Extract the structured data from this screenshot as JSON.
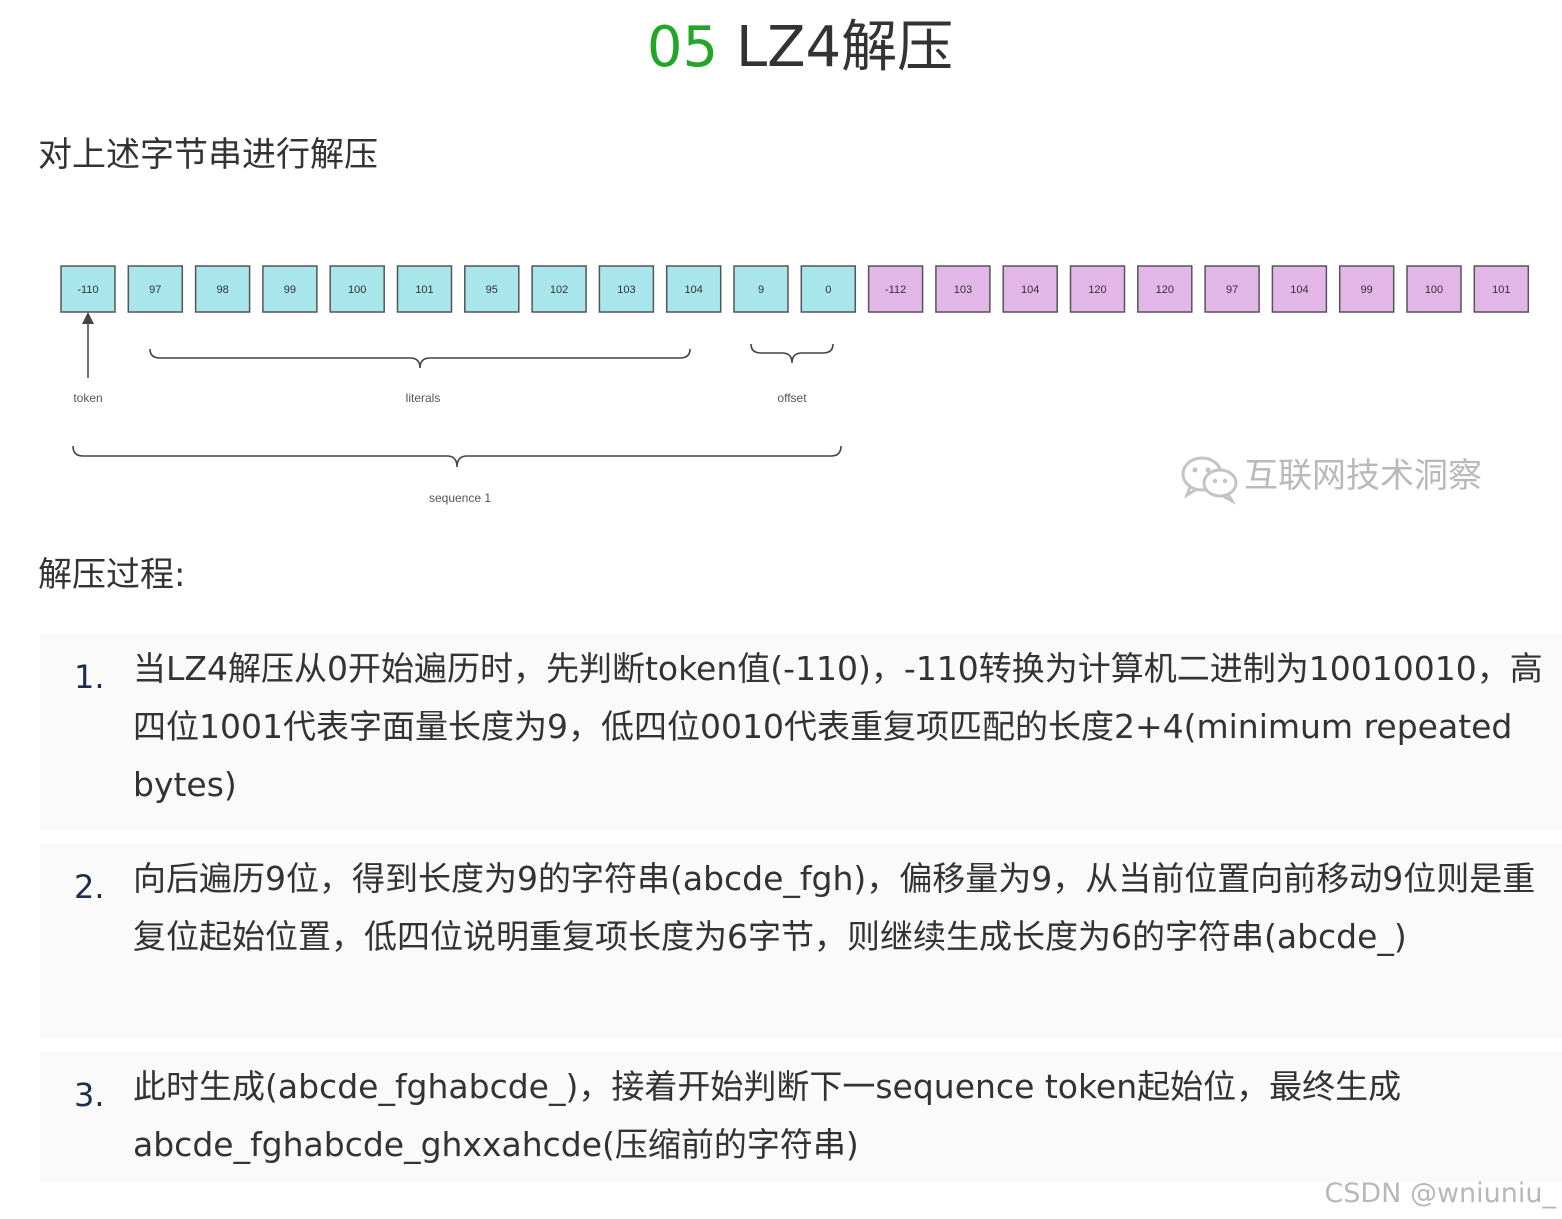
{
  "heading": {
    "number": "05",
    "text": "LZ4解压"
  },
  "intro": "对上述字节串进行解压",
  "diagram": {
    "cyan_color": "#a8e6ec",
    "purple_color": "#e3b6e8",
    "cyan_cells": [
      "-110",
      "97",
      "98",
      "99",
      "100",
      "101",
      "95",
      "102",
      "103",
      "104",
      "9",
      "0"
    ],
    "purple_cells": [
      "-112",
      "103",
      "104",
      "120",
      "120",
      "97",
      "104",
      "99",
      "100",
      "101"
    ],
    "labels": {
      "token": "token",
      "literals": "literals",
      "offset": "offset",
      "sequence": "sequence 1"
    }
  },
  "watermark": {
    "icon": "wechat-icon",
    "text": "互联网技术洞察"
  },
  "process_label": "解压过程:",
  "steps": [
    {
      "marker": "1.",
      "text": "当LZ4解压从0开始遍历时，先判断token值(-110)，-110转换为计算机二进制为10010010，高四位1001代表字面量长度为9，低四位0010代表重复项匹配的长度2+4(minimum repeated bytes)"
    },
    {
      "marker": "2.",
      "text": "向后遍历9位，得到长度为9的字符串(abcde_fgh)，偏移量为9，从当前位置向前移动9位则是重复位起始位置，低四位说明重复项长度为6字节，则继续生成长度为6的字符串(abcde_)"
    },
    {
      "marker": "3.",
      "text": "此时生成(abcde_fghabcde_)，接着开始判断下一sequence token起始位，最终生成abcde_fghabcde_ghxxahcde(压缩前的字符串)"
    }
  ],
  "csdn_credit": "CSDN @wniuniu_"
}
